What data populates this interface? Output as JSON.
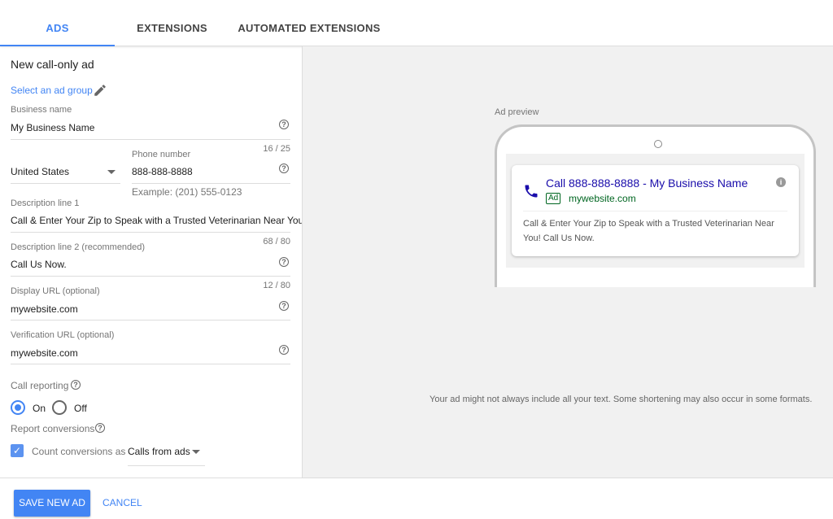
{
  "tabs": [
    {
      "label": "ADS",
      "active": true
    },
    {
      "label": "EXTENSIONS"
    },
    {
      "label": "AUTOMATED EXTENSIONS"
    }
  ],
  "form": {
    "title": "New call-only ad",
    "ad_group_link": "Select an ad group",
    "business_name": {
      "label": "Business name",
      "value": "My Business Name",
      "count": "16 / 25"
    },
    "country": {
      "value": "United States"
    },
    "phone": {
      "label": "Phone number",
      "value": "888-888-8888",
      "hint": "Example: (201) 555-0123"
    },
    "desc1": {
      "label": "Description line 1",
      "value": "Call & Enter Your Zip to Speak with a Trusted Veterinarian Near You!",
      "count": "68 / 80"
    },
    "desc2": {
      "label": "Description line 2 (recommended)",
      "value": "Call Us Now.",
      "count": "12 / 80"
    },
    "display_url": {
      "label": "Display URL (optional)",
      "value": "mywebsite.com"
    },
    "verification_url": {
      "label": "Verification URL (optional)",
      "value": "mywebsite.com"
    },
    "call_reporting": {
      "label": "Call reporting",
      "on": "On",
      "off": "Off",
      "selected": "On"
    },
    "report_conversions": {
      "label": "Report conversions",
      "checkbox_label": "Count conversions as",
      "checked": true,
      "select_value": "Calls from ads"
    }
  },
  "preview": {
    "label": "Ad preview",
    "headline": "Call 888-888-8888 - My Business Name",
    "badge": "Ad",
    "url": "mywebsite.com",
    "description": "Call & Enter Your Zip to Speak with a Trusted Veterinarian Near You! Call Us Now.",
    "note": "Your ad might not always include all your text. Some shortening may also occur in some formats."
  },
  "footer": {
    "save": "SAVE NEW AD",
    "cancel": "CANCEL"
  },
  "colors": {
    "accent": "#4285f4",
    "headline": "#1a0dab",
    "url": "#006621",
    "panel": "#f1f1f1"
  }
}
